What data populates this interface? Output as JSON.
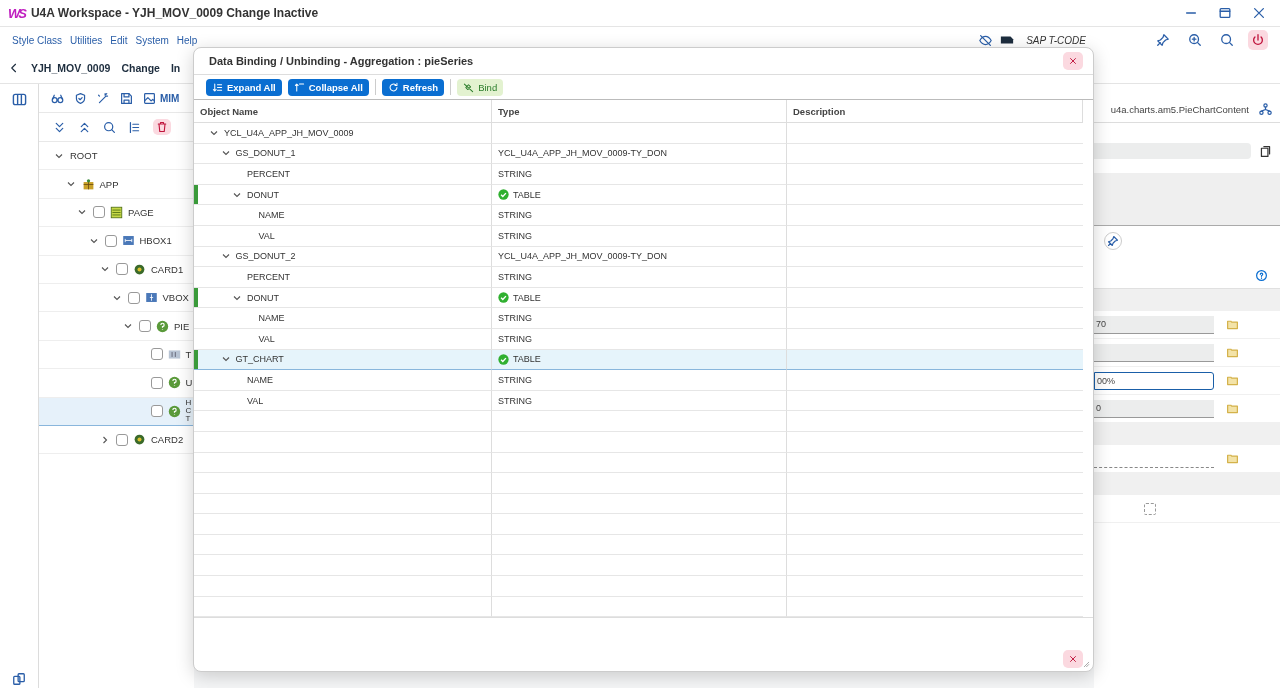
{
  "window": {
    "logo": "WS",
    "title": "U4A Workspace - YJH_MOV_0009 Change Inactive"
  },
  "menu": [
    "Style Class",
    "Utilities",
    "Edit",
    "System",
    "Help"
  ],
  "tcode_label": "SAP T-CODE",
  "header": {
    "app_id": "YJH_MOV_0009",
    "mode": "Change",
    "status": "In"
  },
  "toolbar": {
    "mime_label": "MIM"
  },
  "tree": [
    {
      "label": "ROOT",
      "expanded": true,
      "selected": false,
      "children": [
        {
          "label": "APP",
          "kind": "app",
          "expanded": true,
          "selected": false,
          "children": [
            {
              "label": "PAGE",
              "kind": "page",
              "checked": false,
              "expanded": true,
              "selected": false,
              "children": [
                {
                  "label": "HBOX1",
                  "kind": "hbox",
                  "checked": false,
                  "expanded": true,
                  "selected": false,
                  "children": [
                    {
                      "label": "CARD1",
                      "kind": "card",
                      "checked": false,
                      "expanded": true,
                      "selected": false,
                      "children": [
                        {
                          "label": "VBOX",
                          "kind": "vbox",
                          "checked": false,
                          "expanded": true,
                          "selected": false,
                          "children": [
                            {
                              "label": "PIE",
                              "kind": "chart",
                              "checked": false,
                              "expanded": true,
                              "selected": false,
                              "children": [
                                {
                                  "label": "T",
                                  "kind": "text",
                                  "checked": false,
                                  "selected": false
                                },
                                {
                                  "label": "U",
                                  "kind": "chart",
                                  "checked": false,
                                  "selected": false
                                },
                                {
                                  "label": "HCT",
                                  "kind": "chart",
                                  "checked": false,
                                  "selected": true
                                }
                              ]
                            }
                          ]
                        }
                      ]
                    },
                    {
                      "label": "CARD2",
                      "kind": "card",
                      "checked": false,
                      "expanded": false,
                      "selected": false
                    }
                  ]
                }
              ]
            }
          ]
        }
      ]
    }
  ],
  "right_panel": {
    "class_name": "u4a.charts.am5.PieChartContent",
    "properties": [
      {
        "kind": "field",
        "value": "70",
        "focused": false
      },
      {
        "kind": "field",
        "focused": false
      },
      {
        "kind": "field",
        "value": "00%",
        "focused": true
      },
      {
        "kind": "field",
        "value": "0",
        "focused": false
      },
      {
        "kind": "binding"
      },
      {
        "kind": "checkbox",
        "checked": false
      }
    ]
  },
  "dialog": {
    "title": "Data Binding / Unbinding - Aggregation : pieSeries",
    "buttons": [
      {
        "label": "Expand All",
        "kind": "expand"
      },
      {
        "label": "Collapse All",
        "kind": "collapse"
      },
      {
        "label": "Refresh",
        "kind": "refresh"
      },
      {
        "label": "Bind",
        "kind": "bind"
      }
    ],
    "columns": [
      "Object Name",
      "Type",
      "Description"
    ],
    "rows": [
      {
        "name": "YCL_U4A_APP_JH_MOV_0009",
        "expanded": true,
        "bound": false,
        "selected": false,
        "children": [
          {
            "name": "GS_DONUT_1",
            "type": "YCL_U4A_APP_JH_MOV_0009-TY_DON",
            "expanded": true,
            "bound": false,
            "selected": false,
            "children": [
              {
                "name": "PERCENT",
                "type": "STRING",
                "bound": false,
                "selected": false
              },
              {
                "name": "DONUT",
                "type": "TABLE",
                "expanded": true,
                "bound": true,
                "selected": false,
                "children": [
                  {
                    "name": "NAME",
                    "type": "STRING",
                    "bound": false,
                    "selected": false
                  },
                  {
                    "name": "VAL",
                    "type": "STRING",
                    "bound": false,
                    "selected": false
                  }
                ]
              }
            ]
          },
          {
            "name": "GS_DONUT_2",
            "type": "YCL_U4A_APP_JH_MOV_0009-TY_DON",
            "expanded": true,
            "bound": false,
            "selected": false,
            "children": [
              {
                "name": "PERCENT",
                "type": "STRING",
                "bound": false,
                "selected": false
              },
              {
                "name": "DONUT",
                "type": "TABLE",
                "expanded": true,
                "bound": true,
                "selected": false,
                "children": [
                  {
                    "name": "NAME",
                    "type": "STRING",
                    "bound": false,
                    "selected": false
                  },
                  {
                    "name": "VAL",
                    "type": "STRING",
                    "bound": false,
                    "selected": false
                  }
                ]
              }
            ]
          },
          {
            "name": "GT_CHART",
            "type": "TABLE",
            "expanded": true,
            "bound": true,
            "selected": true,
            "children": [
              {
                "name": "NAME",
                "type": "STRING",
                "bound": false,
                "selected": false
              },
              {
                "name": "VAL",
                "type": "STRING",
                "bound": false,
                "selected": false
              }
            ]
          }
        ]
      }
    ]
  }
}
